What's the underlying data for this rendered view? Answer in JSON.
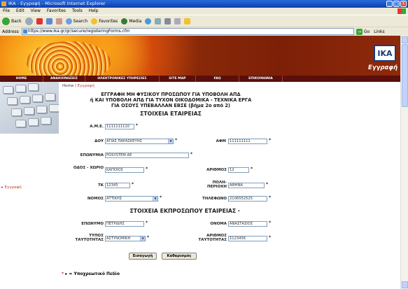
{
  "browser": {
    "title": "IKA - Εγγραφή - Microsoft Internet Explorer",
    "win_min": "_",
    "win_max": "□",
    "win_close": "X",
    "menu": [
      "File",
      "Edit",
      "View",
      "Favorites",
      "Tools",
      "Help"
    ],
    "toolbar": {
      "back": "Back",
      "search": "Search",
      "favorites": "Favorites",
      "media": "Media"
    },
    "address_label": "Address",
    "url": "https://www.ika.gr/gr/secure/registeringForms.cfm",
    "go": "Go",
    "links": "Links"
  },
  "site": {
    "logo": "IKA",
    "page_title": "Εγγραφή",
    "nav": [
      "HOME",
      "ΑΝΑΚΟΙΝΩΣΕΙΣ",
      "ΗΛΕΚΤΡΟΝΙΚΕΣ ΥΠΗΡΕΣΙΕΣ",
      "SITE MAP",
      "FAQ",
      "ΕΠΙΚΟΙΝΩΝΙΑ"
    ],
    "side_link": "Εγγραφή",
    "breadcrumb": {
      "home": "Home",
      "sep": "/",
      "current": "Εγγραφή"
    }
  },
  "form": {
    "heading": [
      "ΕΓΓΡΑΦΗ ΜΗ ΦΥΣΙΚΟΥ ΠΡΟΣΩΠΟΥ ΓΙΑ ΥΠΟΒΟΛΗ ΑΠΔ",
      "ή ΚΑΙ ΥΠΟΒΟΛΗ ΑΠΔ ΓΙΑ ΤΥΧΟΝ ΟΙΚΟΔΟΜΙΚΑ - ΤΕΧΝΙΚΑ ΕΡΓΑ",
      "ΓΙΑ ΟΣΟΥΣ ΥΠΕΒΑΛΛΑΝ ΕΒΣΕ (βήμα 2ο από 2)"
    ],
    "section_company": "ΣΤΟΙΧΕΙΑ ΕΤΑΙΡΕΙΑΣ",
    "section_rep": "ΣΤΟΙΧΕΙΑ ΕΚΠΡΟΣΩΠΟΥ ΕΤΑΙΡΕΙΑΣ",
    "required_mark": "*",
    "fields": {
      "ame_label": "Α.Μ.Ε.",
      "ame_value": "1111111110",
      "doy_label": "ΔΟΥ",
      "doy_value": "ΑΓΙΑΣ ΠΑΡΑΣΚΕΥΗΣ",
      "afm_label": "ΑΦΜ",
      "afm_value": "111111111",
      "eponymia_label": "ΕΠΩΝΥΜΙΑ",
      "eponymia_value": "POSYSTEM AE",
      "odos_label": "ΟΔΟΣ - ΧΩΡΙΟ",
      "odos_value": "ΚΑΠΟΙΟΣ",
      "arithmos_label": "ΑΡΙΘΜΟΣ",
      "arithmos_value": "12",
      "tk_label": "ΤΚ",
      "tk_value": "12345",
      "poli_label": "ΠΟΛΗ-ΠΕΡΙΟΧΗ",
      "poli_value": "ΑΘΗΝΑ",
      "nomos_label": "ΝΟΜΟΣ",
      "nomos_value": "ΑΤΤΙΚΗΣ",
      "tilefono_label": "ΤΗΛΕΦΩΝΟ",
      "tilefono_value": "2106552525",
      "eponymo_label": "ΕΠΩΝΥΜΟ",
      "eponymo_value": "ΠΕΤΡΙΔΗΣ",
      "onoma_label": "ΟΝΟΜΑ",
      "onoma_value": "ΑΝΑΣΤΑΣΙΟΣ",
      "typos_label": "ΤΥΠΟΣ ΤΑΥΤΟΤΗΤΑΣ",
      "typos_value": "ΑΣΤΥΝΟΜΙΚΗ",
      "ar_taut_label": "ΑΡΙΘΜΟΣ ΤΑΥΤΟΤΗΤΑΣ",
      "ar_taut_value": "Σ123456"
    },
    "submit": "Εισαγωγή",
    "clear": "Καθαρισμός",
    "bottom_link": "Υποχρεωτικό Πεδίο"
  },
  "colors": {
    "nav_bg": "#5a0f0a",
    "accent": "#c0392b",
    "title_blue": "#0b3fb0"
  }
}
